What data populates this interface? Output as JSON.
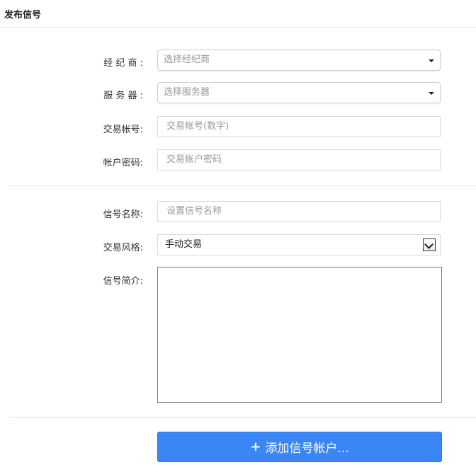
{
  "page": {
    "title": "发布信号"
  },
  "form": {
    "broker": {
      "label": "经 纪 商 :",
      "placeholder": "选择经纪商"
    },
    "server": {
      "label": "服 务 器 :",
      "placeholder": "选择服务器"
    },
    "trade_account": {
      "label": "交易帐号:",
      "placeholder": "交易帐号(数字)"
    },
    "account_password": {
      "label": "帐户密码:",
      "placeholder": "交易帐户密码"
    },
    "signal_name": {
      "label": "信号名称:",
      "placeholder": "设置信号名称"
    },
    "trade_style": {
      "label": "交易风格:",
      "value": "手动交易"
    },
    "signal_intro": {
      "label": "信号简介:",
      "value": ""
    }
  },
  "actions": {
    "add_account": {
      "icon": "plus-icon",
      "label": "添加信号帐户..."
    }
  },
  "colors": {
    "primary": "#3b86f6",
    "border": "#d9d9d9",
    "divider": "#e6e6e6"
  }
}
